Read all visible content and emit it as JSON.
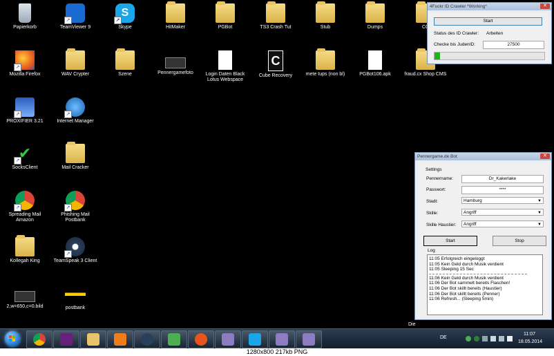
{
  "desktop_icons": [
    {
      "label": "Papierkorb",
      "icon": "recycle-bin-icon"
    },
    {
      "label": "TeamViewer 9",
      "icon": "teamviewer-icon"
    },
    {
      "label": "Skype",
      "icon": "skype-icon"
    },
    {
      "label": "HitMaker",
      "icon": "folder-icon"
    },
    {
      "label": "PGBot",
      "icon": "folder-icon"
    },
    {
      "label": "TS3 Crash Tut",
      "icon": "folder-icon"
    },
    {
      "label": "Stub",
      "icon": "folder-icon"
    },
    {
      "label": "Dumps",
      "icon": "folder-icon"
    },
    {
      "label": "CC",
      "icon": "folder-icon"
    },
    {
      "label": "Mozilla Firefox",
      "icon": "firefox-icon"
    },
    {
      "label": "WAV Crypter",
      "icon": "folder-icon"
    },
    {
      "label": "Szene",
      "icon": "folder-icon"
    },
    {
      "label": "Pennergamefoto",
      "icon": "image-file-icon"
    },
    {
      "label": "Login Daten Black Lotus Webspace",
      "icon": "text-file-icon"
    },
    {
      "label": "Cube Recovery",
      "icon": "cube-recovery-icon"
    },
    {
      "label": "mete tups (non bl)",
      "icon": "folder-icon"
    },
    {
      "label": "PGBot106.apk",
      "icon": "file-icon"
    },
    {
      "label": "fraud.cx Shop CMS",
      "icon": "folder-icon"
    },
    {
      "label": "PROXIFIER 3.21",
      "icon": "proxifier-icon"
    },
    {
      "label": "Internet Manager",
      "icon": "internet-manager-icon"
    },
    {
      "label": "SocksClient",
      "icon": "check-icon"
    },
    {
      "label": "Mail Cracker",
      "icon": "folder-icon"
    },
    {
      "label": "Spreading Mail Amazon",
      "icon": "chrome-icon"
    },
    {
      "label": "Phishing Mail Postbank",
      "icon": "chrome-icon"
    },
    {
      "label": "Kollegah King",
      "icon": "folder-icon"
    },
    {
      "label": "TeamSpeak 3 Client",
      "icon": "teamspeak-icon"
    },
    {
      "label": "2,w=650,c=0.bild",
      "icon": "image-file-icon"
    },
    {
      "label": "postbank",
      "icon": "postbank-icon"
    }
  ],
  "crawler": {
    "title": "4Fuckr ID Crawler *Working*",
    "start": "Start",
    "status_label": "Status des ID Crawler:",
    "status_value": "Arbeiten",
    "check_label": "Checke bis JudenID:",
    "check_value": "27500",
    "progress": 0.05
  },
  "bot": {
    "title": "Pennergame.de Bot",
    "settings": "Settings",
    "pennername_label": "Pennername:",
    "pennername_value": "Dr_Kakerlake",
    "password_label": "Passwort:",
    "password_value": "****",
    "stadt_label": "Stadt:",
    "stadt_value": "Hamburg",
    "skille_label": "Skille:",
    "skille_value": "Angriff",
    "haustier_label": "Skille Haustier:",
    "haustier_value": "Angriff",
    "start": "Start",
    "stop": "Stop",
    "log_label": "Log",
    "log_lines_a": [
      "11:05 Erfolgreich eingeloggt",
      "11:05 Kein Geld durch Musik verdient",
      "11:05 Sleeping 15 Sec"
    ],
    "log_lines_b": [
      "11:06 Kein Geld durch Musik verdient",
      "11:06 Der Bot sammelt bereits Flaschen!",
      "11:06 Der Bot skillt bereits (Haustier)",
      "11:06 Der Bot skillt bereits (Penner)",
      "11:06 Refresh... (Sleeping 5min)"
    ]
  },
  "partial_text": "Die",
  "taskbar": {
    "lang": "DE",
    "time": "11:07",
    "date": "18.05.2014",
    "items": [
      "chrome-icon",
      "visual-studio-icon",
      "explorer-icon",
      "media-player-icon",
      "teamspeak-icon",
      "notepad-icon",
      "firefox-icon",
      "app-icon",
      "skype-icon",
      "app-icon",
      "app-icon"
    ]
  },
  "caption": "1280x800  217kb  PNG"
}
